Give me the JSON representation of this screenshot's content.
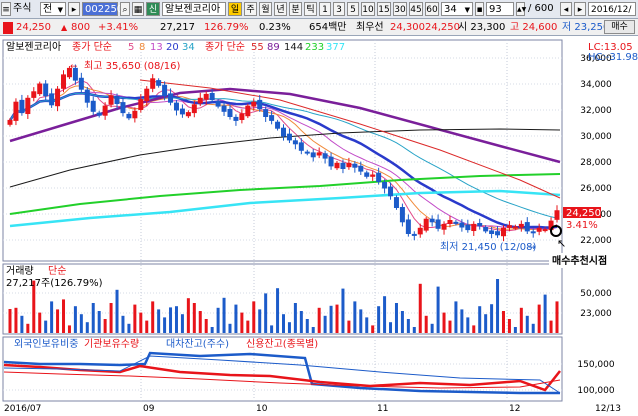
{
  "toolbar": {
    "market_label": "주식",
    "market_dropdown": "전",
    "stock_code": "002250",
    "stock_name": "알보젠코리아",
    "type_badge": "신",
    "period_buttons": [
      "일",
      "주",
      "월",
      "년",
      "분",
      "틱"
    ],
    "min_buttons": [
      "1",
      "3",
      "5",
      "10",
      "15",
      "30",
      "45",
      "60"
    ],
    "min_value": "34",
    "count_value": "93",
    "count_total": "/ 600",
    "date_value": "2016/12/"
  },
  "quote": {
    "price": "24,250",
    "change": "800",
    "change_pct": "+3.41%",
    "volume": "27,217",
    "volume_ratio": "126.79%",
    "turnover_rate": "0.23%",
    "trade_amount": "654백만",
    "best_ask_label": "최우선",
    "best_ask": "24,300",
    "best_bid": "24,250",
    "open": "시 23,300",
    "high": "고 24,600",
    "low": "저 23,250",
    "buy_button": "매수"
  },
  "panel_price": {
    "name": "알보젠코리아",
    "ma_label": "종가 단순",
    "ma_periods": [
      "5",
      "8",
      "13",
      "20",
      "34"
    ],
    "ma_label_2": "종가 단순",
    "ma_periods_2": [
      "55",
      "89",
      "144",
      "233",
      "377"
    ],
    "lc_text": "LC:13.05",
    "hc_text": "HC:-31.98",
    "high_note": "최고 35,650 (08/16)",
    "low_note": "최저 21,450 (12/08)",
    "signal_label": "매수추천시점",
    "last_price_tag": "24,250",
    "last_pct_tag": "3.41%"
  },
  "panel_volume": {
    "title": "거래량",
    "subtitle": "단순",
    "value": "27,217주(126.79%)"
  },
  "panel_supply": {
    "items": [
      "외국인보유비중",
      "기관보유수량",
      "대차잔고(주수)",
      "신용잔고(종목별)"
    ]
  },
  "colors": {
    "up": "#e8141a",
    "down": "#1c5bc9",
    "ma5": "#e24b8a",
    "ma8": "#f08a3a",
    "ma13": "#c24cc8",
    "ma20": "#2a3acb",
    "ma34": "#27a3c7",
    "ma55": "#dc2a2a",
    "ma89": "#7a1f9a",
    "ma144": "#1a1a1a",
    "ma233": "#22d02a",
    "ma377": "#37e4f5"
  },
  "chart_data": {
    "type": "candlestick",
    "y_axis_price": [
      "36,000",
      "34,000",
      "32,000",
      "30,000",
      "28,000",
      "26,000",
      "24,000",
      "22,000"
    ],
    "y_axis_volume": [
      "50,000",
      "23,000"
    ],
    "y_axis_supply": [
      "150,000",
      "100,000"
    ],
    "x_labels": [
      "2016/07",
      "09",
      "10",
      "11",
      "12",
      "12/13"
    ],
    "closes": [
      31200,
      32600,
      31800,
      32900,
      33400,
      34000,
      33100,
      32400,
      33600,
      34700,
      35200,
      34300,
      33600,
      32600,
      31900,
      31600,
      32300,
      33100,
      32500,
      31800,
      31400,
      31900,
      32800,
      33600,
      34400,
      33900,
      33100,
      32600,
      32000,
      31700,
      31800,
      32400,
      32900,
      33200,
      32800,
      32300,
      31900,
      31500,
      31200,
      31700,
      32300,
      32600,
      32100,
      31500,
      31200,
      30600,
      30000,
      29700,
      29400,
      28900,
      28700,
      28400,
      28700,
      28300,
      27700,
      27900,
      27500,
      27900,
      27600,
      27300,
      26900,
      27000,
      26500,
      26000,
      25400,
      24500,
      23400,
      22500,
      22400,
      22900,
      23600,
      23400,
      22900,
      23200,
      23500,
      23300,
      23000,
      22800,
      23200,
      23100,
      22700,
      22500,
      22400,
      22900,
      23100,
      23000,
      23200,
      22700,
      22600,
      22900,
      22800,
      23450,
      24250
    ]
  }
}
